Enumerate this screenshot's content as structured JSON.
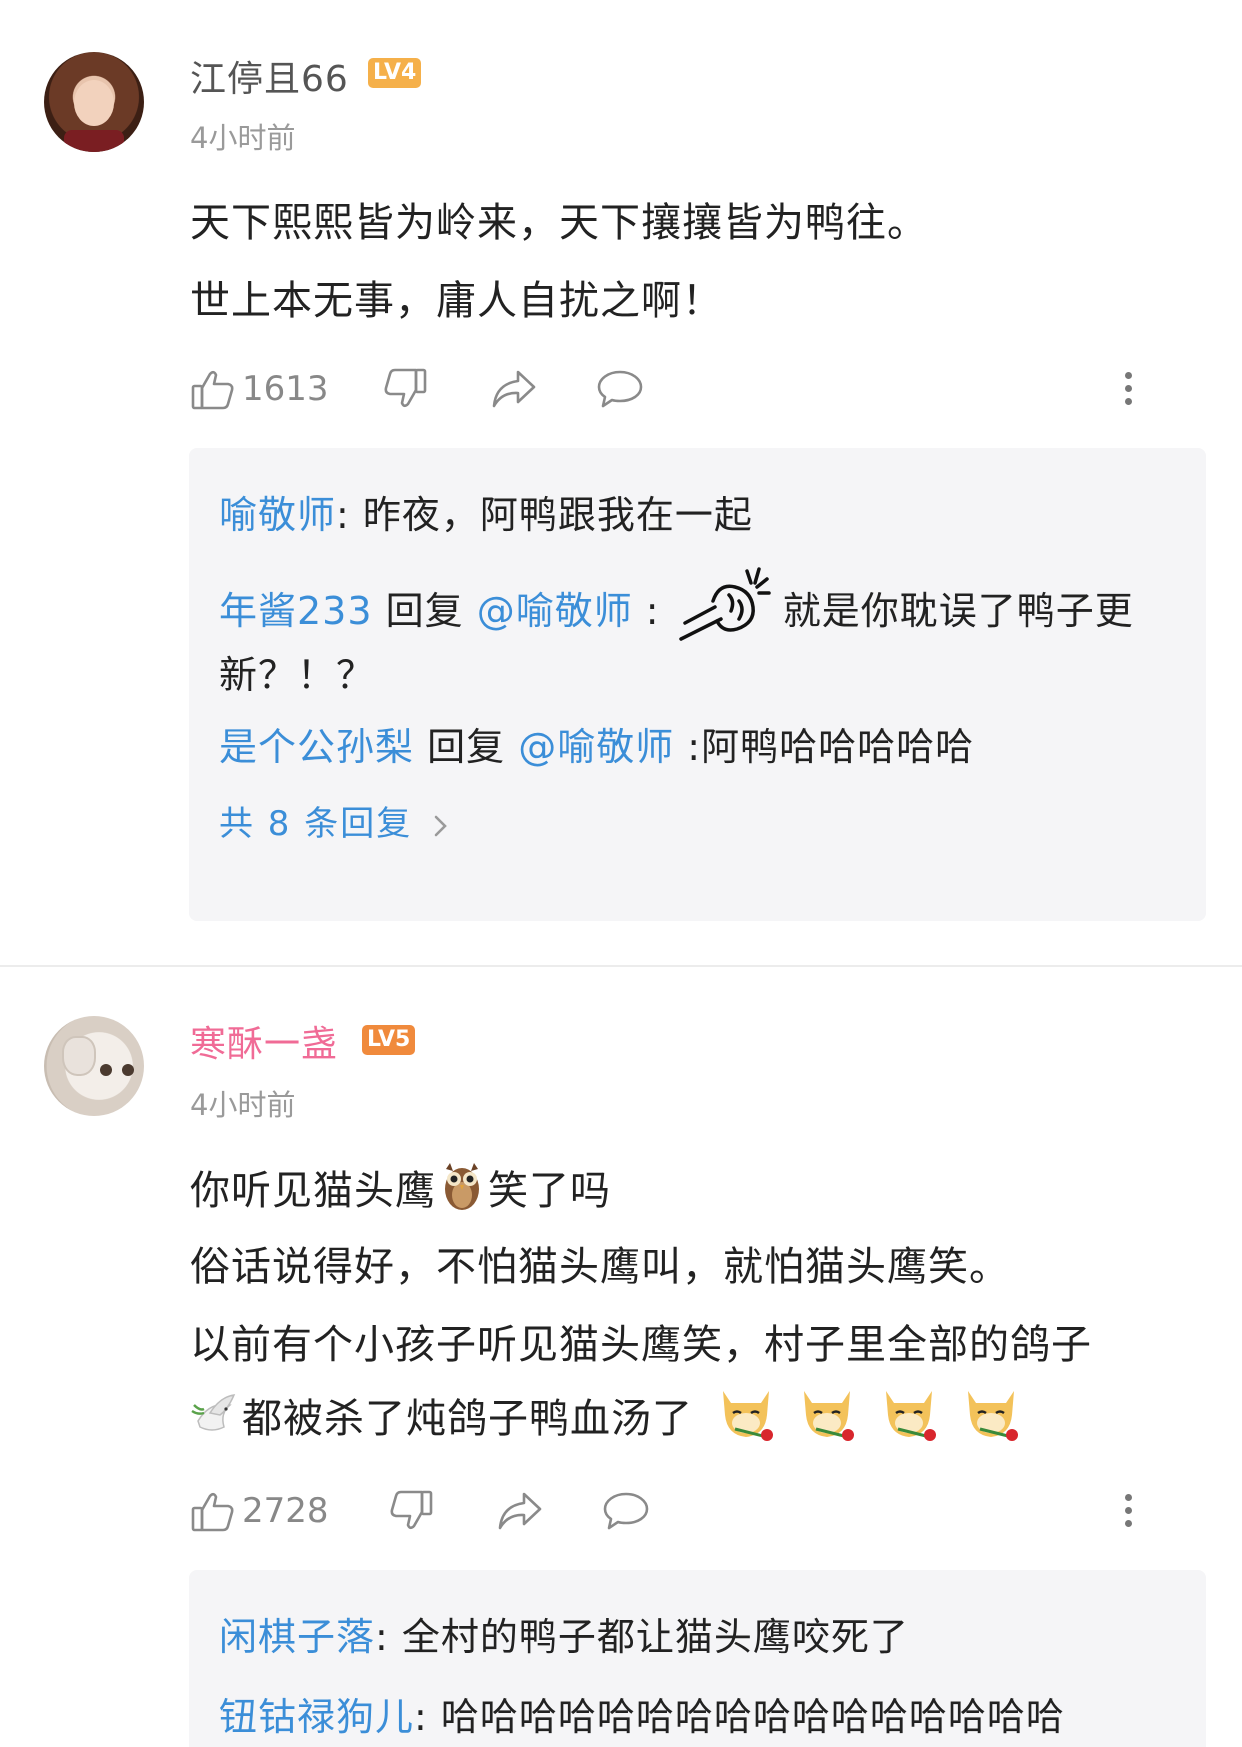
{
  "comments": [
    {
      "username": "江停且66",
      "level": "LV4",
      "time": "4小时前",
      "lines": [
        "天下熙熙皆为岭来，天下攘攘皆为鸭往。",
        "世上本无事，庸人自扰之啊！"
      ],
      "likes": "1613",
      "replies": [
        {
          "author": "喻敬师",
          "sep": ": ",
          "text": "昨夜，阿鸭跟我在一起"
        },
        {
          "author": "年酱233",
          "reply_word": " 回复 ",
          "target": "@喻敬师",
          "sep": " : ",
          "text": "就是你耽误了鸭子更",
          "text_cont": "新？！？"
        },
        {
          "author": "是个公孙梨",
          "reply_word": " 回复 ",
          "target": "@喻敬师",
          "sep": " :",
          "text": "阿鸭哈哈哈哈哈"
        }
      ],
      "more_replies": "共 8 条回复"
    },
    {
      "username": "寒酥一盏",
      "level": "LV5",
      "time": "4小时前",
      "line1a": "你听见猫头鹰",
      "line1b": "笑了吗",
      "line2": "俗话说得好，不怕猫头鹰叫，就怕猫头鹰笑。",
      "line3": "以前有个小孩子听见猫头鹰笑，村子里全部的鸽子",
      "line4": "都被杀了炖鸽子鸭血汤了",
      "likes": "2728",
      "replies": [
        {
          "author": "闲棋子落",
          "sep": ": ",
          "text": "全村的鸭子都让猫头鹰咬死了"
        },
        {
          "author": "钮钴禄狗儿",
          "sep": ": ",
          "text": "哈哈哈哈哈哈哈哈哈哈哈哈哈哈哈哈"
        }
      ]
    }
  ],
  "icons": {
    "like": "thumbs-up-icon",
    "dislike": "thumbs-down-icon",
    "share": "share-arrow-icon",
    "comment": "speech-bubble-icon",
    "more": "more-vertical-icon"
  },
  "colors": {
    "link": "#3b8ed8",
    "pink_name": "#f06b96",
    "lv4": "#f5b04a",
    "lv5": "#f08a3c"
  }
}
